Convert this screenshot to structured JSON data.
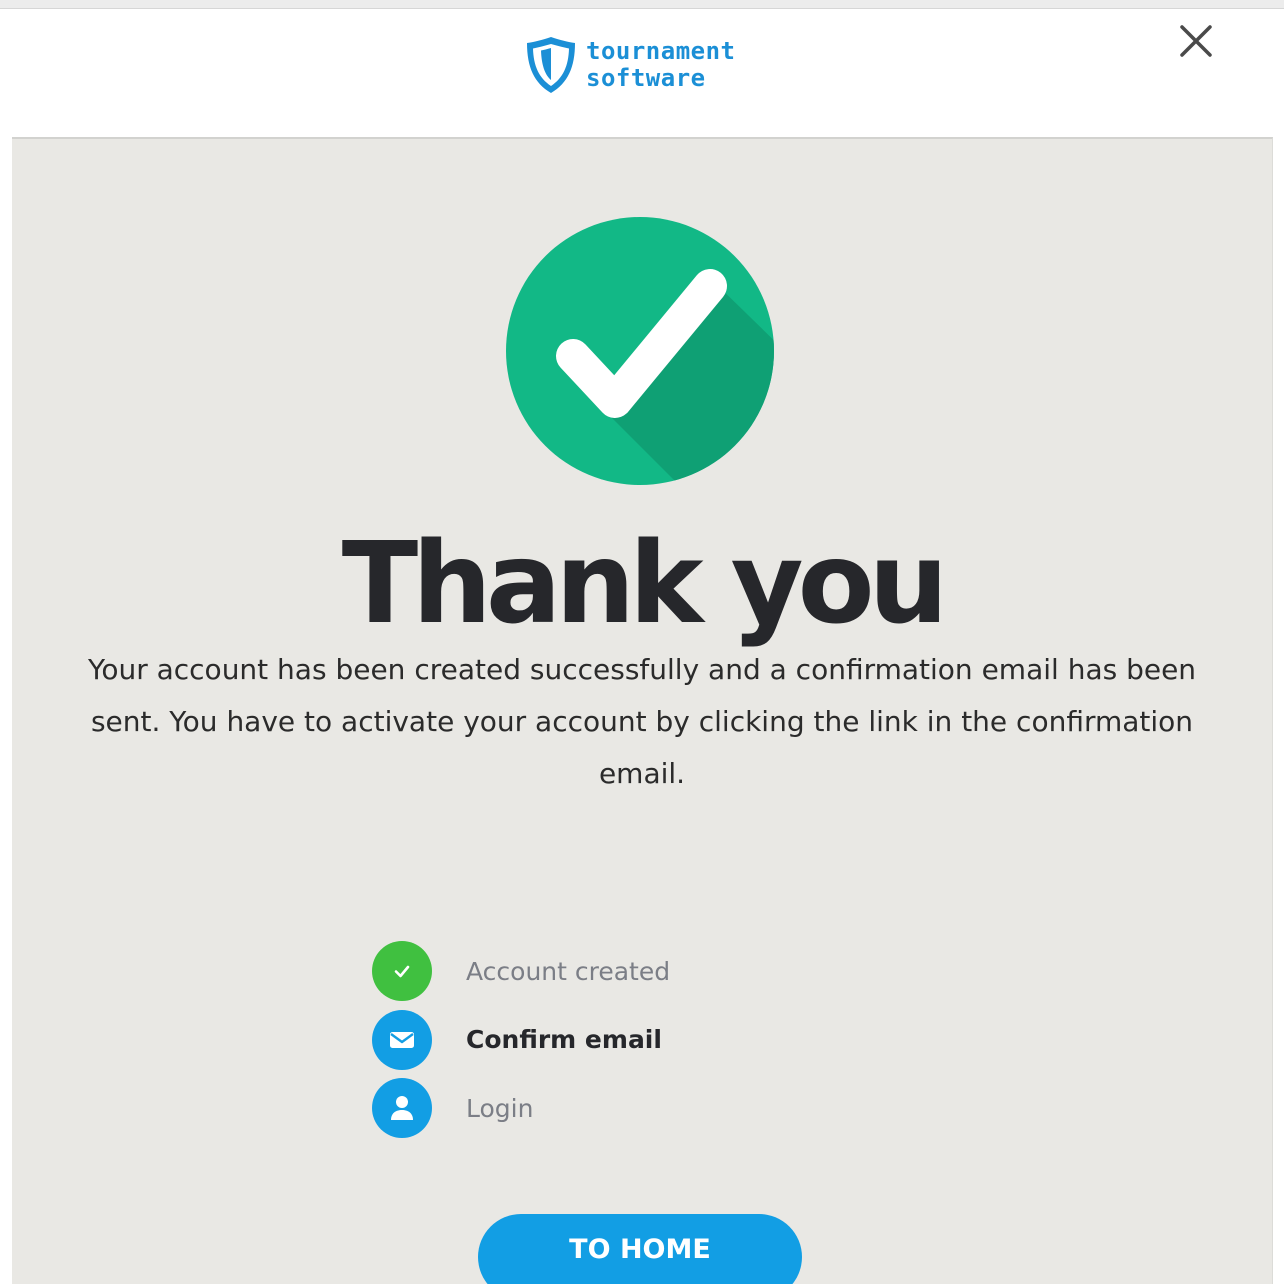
{
  "header": {
    "logo_line1": "tournament",
    "logo_line2": "software",
    "close_label": "Close"
  },
  "main": {
    "title": "Thank you",
    "message": "Your account has been created successfully and a confirmation email has been sent. You have to activate your account by clicking the link in the confirmation email.",
    "steps": [
      {
        "label": "Account created",
        "icon": "check-icon",
        "state": "done"
      },
      {
        "label": "Confirm email",
        "icon": "envelope-icon",
        "state": "active"
      },
      {
        "label": "Login",
        "icon": "user-icon",
        "state": "pending"
      }
    ],
    "home_button_label": "TO HOME"
  },
  "colors": {
    "brand_blue": "#1b8fd6",
    "success_green": "#12b886",
    "step_done_green": "#40c040",
    "step_blue": "#129ee4",
    "background": "#e9e8e4"
  }
}
